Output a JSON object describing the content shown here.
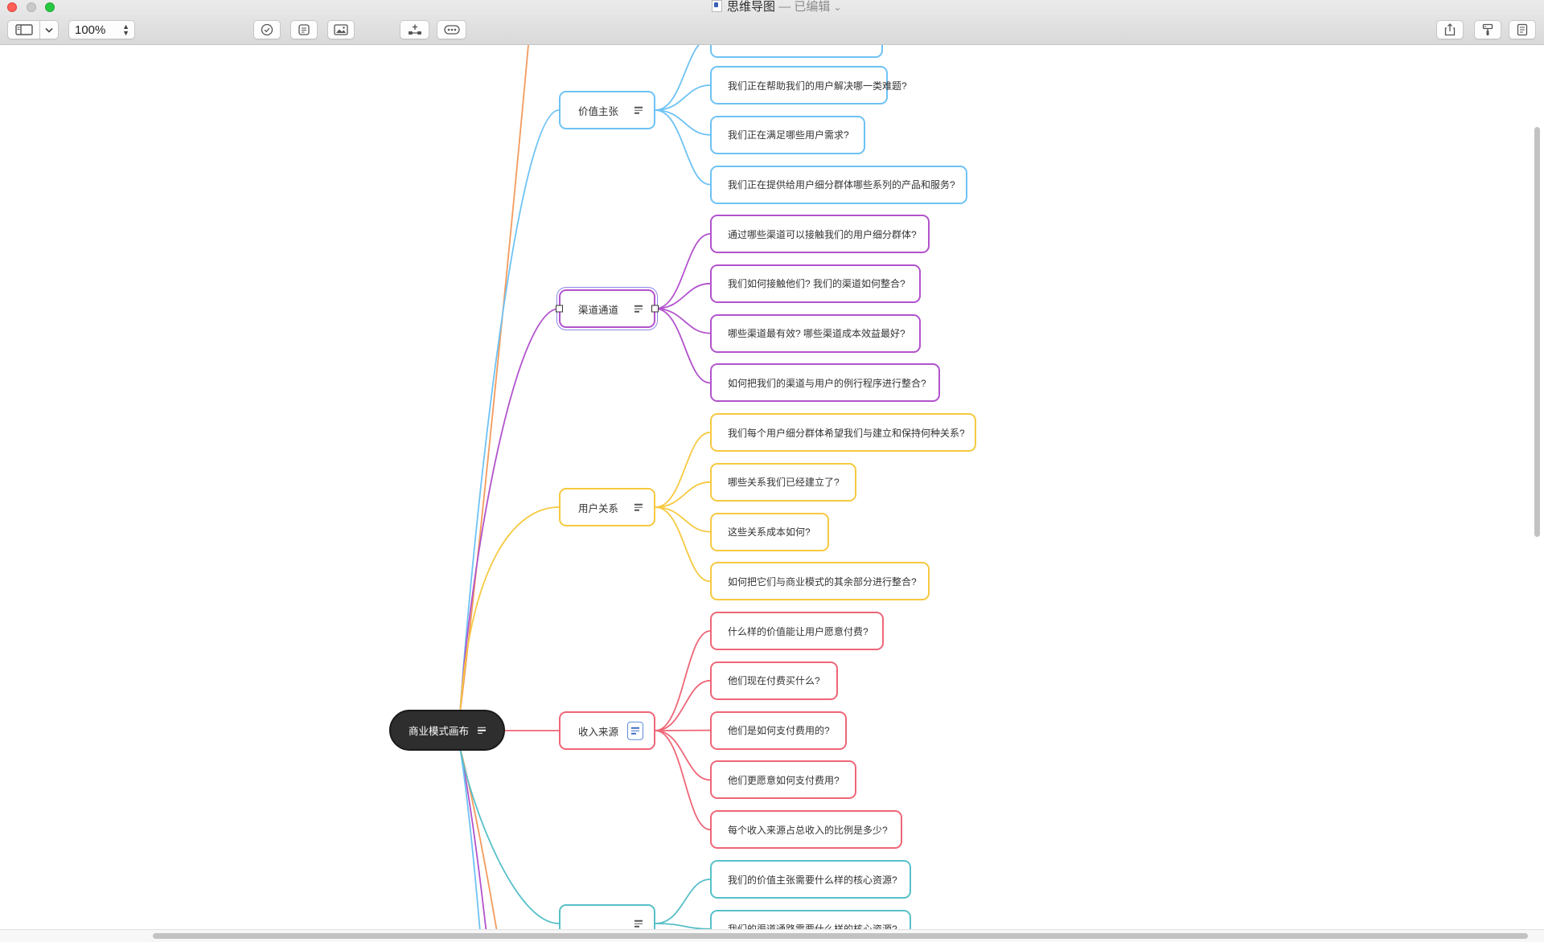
{
  "window": {
    "title": "思维导图",
    "subtitle": " — 已编辑",
    "chevron": "⌄"
  },
  "toolbar": {
    "zoom_value": "100%",
    "sidebar_icon": "sidebar-icon",
    "chevron_icon": "chevron-down-icon",
    "task_icon": "checkmark-icon",
    "notes_icon": "notes-icon",
    "image_icon": "image-icon",
    "add_topic_icon": "add-topic-icon",
    "more_icon": "more-icon",
    "share_icon": "share-icon",
    "format_icon": "format-brush-icon",
    "outline_icon": "outline-icon"
  },
  "colors": {
    "blue": "#6ec2f4",
    "purple": "#b253cc",
    "yellow": "#f6c940",
    "red": "#ee6677",
    "teal": "#57c0c8",
    "orange": "#f39a5c",
    "root_fill": "#2e2e2e",
    "selection": "#8d87e8"
  },
  "mindmap": {
    "root": {
      "label": "商业模式画布"
    },
    "branches": [
      {
        "label": "价值主张",
        "children": [
          "我们正在帮助我们的用户解决哪一类难题?",
          "我们正在满足哪些用户需求?",
          "我们正在提供给用户细分群体哪些系列的产品和服务?"
        ]
      },
      {
        "label": "渠道通道",
        "children": [
          "通过哪些渠道可以接触我们的用户细分群体?",
          "我们如何接触他们? 我们的渠道如何整合?",
          "哪些渠道最有效? 哪些渠道成本效益最好?",
          "如何把我们的渠道与用户的例行程序进行整合?"
        ]
      },
      {
        "label": "用户关系",
        "children": [
          "我们每个用户细分群体希望我们与建立和保持何种关系?",
          "哪些关系我们已经建立了?",
          "这些关系成本如何?",
          "如何把它们与商业模式的其余部分进行整合?"
        ]
      },
      {
        "label": "收入来源",
        "children": [
          "什么样的价值能让用户愿意付费?",
          "他们现在付费买什么?",
          "他们是如何支付费用的?",
          "他们更愿意如何支付费用?",
          "每个收入来源占总收入的比例是多少?"
        ]
      },
      {
        "label": "",
        "children": [
          "我们的价值主张需要什么样的核心资源?",
          "我们的渠道通路需要什么样的核心资源?"
        ]
      }
    ]
  }
}
